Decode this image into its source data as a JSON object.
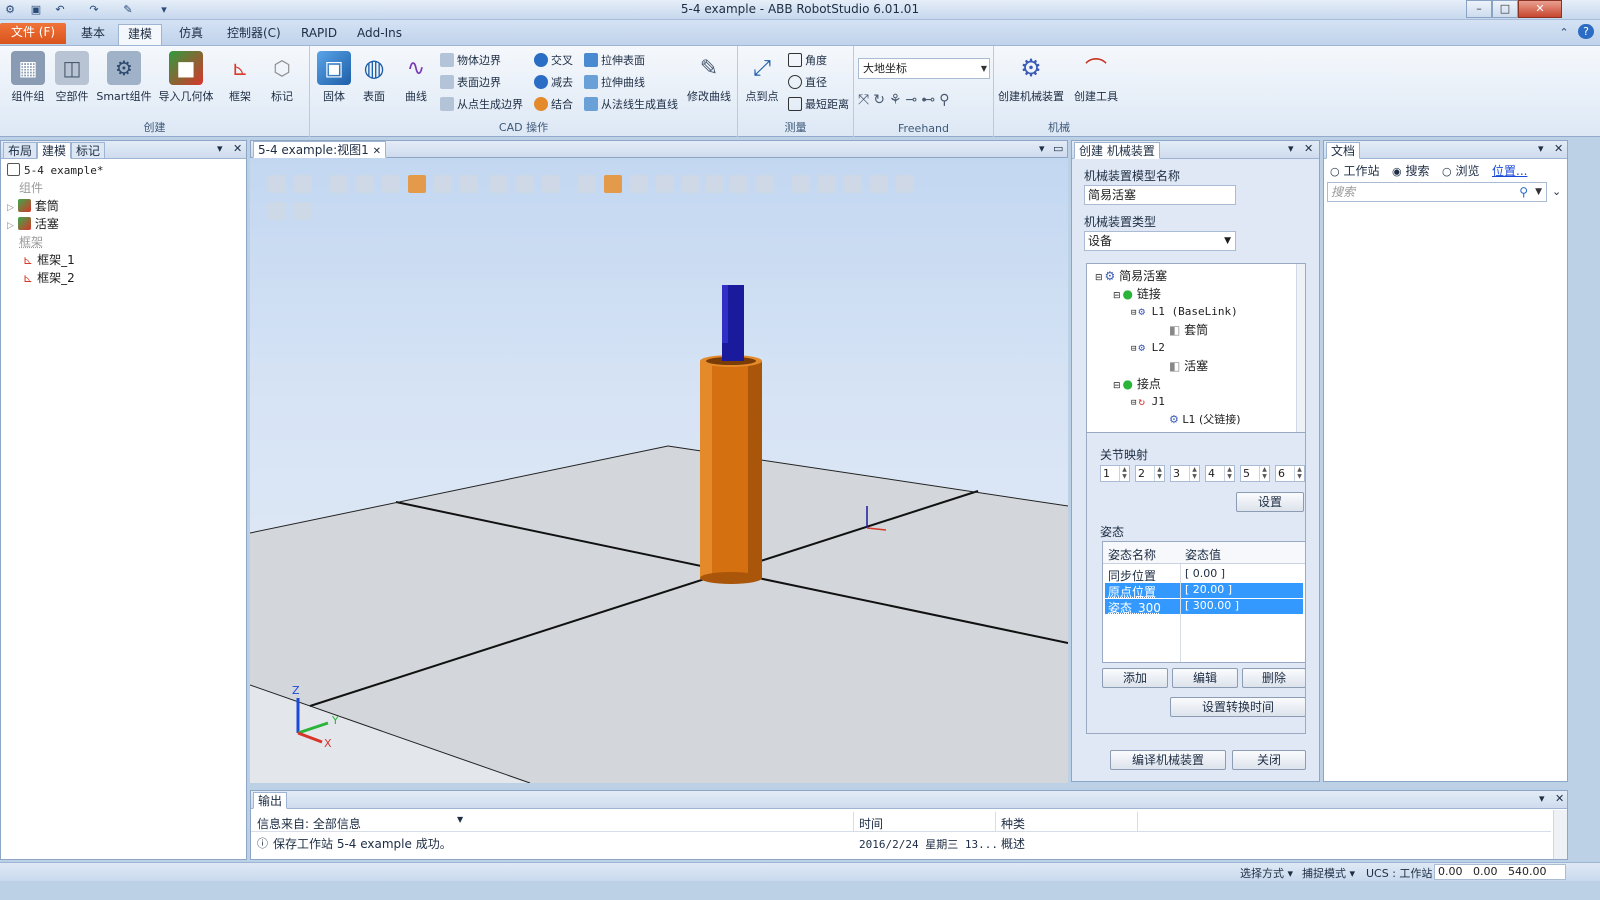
{
  "window": {
    "title": "5-4 example - ABB RobotStudio 6.01.01",
    "minimize": "–",
    "maximize": "□",
    "close": "✕"
  },
  "ribbon_tabs": [
    {
      "label": "文件 (F)"
    },
    {
      "label": "基本"
    },
    {
      "label": "建模"
    },
    {
      "label": "仿真"
    },
    {
      "label": "控制器(C)"
    },
    {
      "label": "RAPID"
    },
    {
      "label": "Add-Ins"
    }
  ],
  "ribbon": {
    "create": {
      "group_label": "创建",
      "buttons": [
        {
          "label": "组件组"
        },
        {
          "label": "空部件"
        },
        {
          "label": "Smart组件"
        },
        {
          "label": "导入几何体"
        },
        {
          "label": "框架"
        },
        {
          "label": "标记"
        }
      ]
    },
    "cad": {
      "group_label": "CAD 操作",
      "big": [
        {
          "label": "固体"
        },
        {
          "label": "表面"
        },
        {
          "label": "曲线"
        }
      ],
      "col1": [
        {
          "label": "物体边界"
        },
        {
          "label": "表面边界"
        },
        {
          "label": "从点生成边界"
        }
      ],
      "col2": [
        {
          "label": "交叉"
        },
        {
          "label": "减去"
        },
        {
          "label": "结合"
        }
      ],
      "col3": [
        {
          "label": "拉伸表面"
        },
        {
          "label": "拉伸曲线"
        },
        {
          "label": "从法线生成直线"
        }
      ],
      "modify": {
        "label": "修改曲线"
      }
    },
    "measure": {
      "group_label": "测量",
      "big": {
        "label": "点到点"
      },
      "small": [
        {
          "label": "角度"
        },
        {
          "label": "直径"
        },
        {
          "label": "最短距离"
        }
      ]
    },
    "freehand": {
      "group_label": "Freehand",
      "combo_value": "大地坐标"
    },
    "mechanism": {
      "group_label": "机械",
      "buttons": [
        {
          "label": "创建机械装置"
        },
        {
          "label": "创建工具"
        }
      ]
    }
  },
  "left_panel": {
    "tabs": [
      {
        "label": "布局"
      },
      {
        "label": "建模"
      },
      {
        "label": "标记"
      }
    ],
    "tree": {
      "root": "5-4 example*",
      "components_header": "组件",
      "components": [
        {
          "label": "套筒"
        },
        {
          "label": "活塞"
        }
      ],
      "frames_header": "框架",
      "frames": [
        {
          "label": "框架_1"
        },
        {
          "label": "框架_2"
        }
      ]
    }
  },
  "viewport": {
    "tab_label": "5-4 example:视图1",
    "axis": {
      "x": "X",
      "y": "Y",
      "z": "Z"
    }
  },
  "mech_panel": {
    "tab_label": "创建 机械装置",
    "model_name_label": "机械装置模型名称",
    "model_name_value": "简易活塞",
    "type_label": "机械装置类型",
    "type_value": "设备",
    "tree": [
      {
        "label": "简易活塞",
        "kind": "root"
      },
      {
        "label": "链接",
        "kind": "check"
      },
      {
        "label": "L1 (BaseLink)",
        "kind": "gear"
      },
      {
        "label": "套筒",
        "kind": "part"
      },
      {
        "label": "L2",
        "kind": "gear"
      },
      {
        "label": "活塞",
        "kind": "part"
      },
      {
        "label": "接点",
        "kind": "check"
      },
      {
        "label": "J1",
        "kind": "joint"
      },
      {
        "label": "L1 (父链接)",
        "kind": "gear"
      }
    ],
    "joint_map_label": "关节映射",
    "joint_map": [
      "1",
      "2",
      "3",
      "4",
      "5",
      "6"
    ],
    "set_button": "设置",
    "pose_label": "姿态",
    "pose_table": {
      "headers": [
        "姿态名称",
        "姿态值"
      ],
      "rows": [
        {
          "name": "同步位置",
          "value": "[ 0.00 ]",
          "selected": false
        },
        {
          "name": "原点位置",
          "value": "[ 20.00 ]",
          "selected": true
        },
        {
          "name": "姿态_300",
          "value": "[ 300.00 ]",
          "selected": true
        }
      ]
    },
    "add_button": "添加",
    "edit_button": "编辑",
    "delete_button": "删除",
    "transition_button": "设置转换时间",
    "compile_button": "编译机械装置",
    "close_button": "关闭"
  },
  "docs_panel": {
    "tab_label": "文档",
    "radio_station": "工作站",
    "radio_search": "搜索",
    "radio_browse": "浏览",
    "location_link": "位置...",
    "search_placeholder": "搜索"
  },
  "output": {
    "tab_label": "输出",
    "filter_label": "信息来自: 全部信息",
    "col_time": "时间",
    "col_kind": "种类",
    "rows": [
      {
        "message": "保存工作站 5-4 example 成功。",
        "time": "2016/2/24 星期三 13...",
        "kind": "概述"
      }
    ]
  },
  "status": {
    "select_mode": "选择方式 ▾",
    "snap_mode": "捕捉模式 ▾",
    "ucs": "UCS : 工作站",
    "coords": "0.00   0.00   540.00"
  },
  "colors": {
    "file_tab": "#e3602a",
    "selection": "#3399ff",
    "sleeve": "#d4700f",
    "piston": "#1a1a9c"
  }
}
